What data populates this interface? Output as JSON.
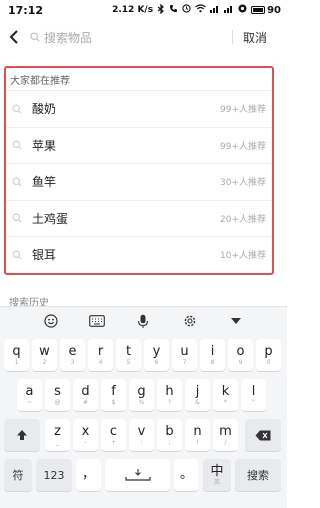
{
  "status_bar": {
    "time": "17:12",
    "speed": "2.12 K/s",
    "battery": "90"
  },
  "search": {
    "placeholder": "搜索物品",
    "cancel_label": "取消"
  },
  "recommend": {
    "title": "大家都在推荐",
    "items": [
      {
        "name": "酸奶",
        "count": "99+人推荐"
      },
      {
        "name": "苹果",
        "count": "99+人推荐"
      },
      {
        "name": "鱼竿",
        "count": "30+人推荐"
      },
      {
        "name": "土鸡蛋",
        "count": "20+人推荐"
      },
      {
        "name": "银耳",
        "count": "10+人推荐"
      }
    ]
  },
  "history": {
    "title": "搜索历史"
  },
  "keyboard": {
    "row1": [
      {
        "main": "q",
        "sub": "1"
      },
      {
        "main": "w",
        "sub": "2"
      },
      {
        "main": "e",
        "sub": "3"
      },
      {
        "main": "r",
        "sub": "4"
      },
      {
        "main": "t",
        "sub": "5"
      },
      {
        "main": "y",
        "sub": "6"
      },
      {
        "main": "u",
        "sub": "7"
      },
      {
        "main": "i",
        "sub": "8"
      },
      {
        "main": "o",
        "sub": "9"
      },
      {
        "main": "p",
        "sub": "0"
      }
    ],
    "row2": [
      {
        "main": "a",
        "sub": "~"
      },
      {
        "main": "s",
        "sub": "@"
      },
      {
        "main": "d",
        "sub": "#"
      },
      {
        "main": "f",
        "sub": "$"
      },
      {
        "main": "g",
        "sub": "%"
      },
      {
        "main": "h",
        "sub": "?"
      },
      {
        "main": "j",
        "sub": "&"
      },
      {
        "main": "k",
        "sub": "*"
      },
      {
        "main": "l",
        "sub": "\""
      }
    ],
    "row3": [
      {
        "main": "z",
        "sub": "_"
      },
      {
        "main": "x",
        "sub": "-"
      },
      {
        "main": "c",
        "sub": "+"
      },
      {
        "main": "v",
        "sub": ":"
      },
      {
        "main": "b",
        "sub": ";"
      },
      {
        "main": "n",
        "sub": "!"
      },
      {
        "main": "m",
        "sub": "/"
      }
    ],
    "symbol_label": "符",
    "number_label": "123",
    "comma_label": "，",
    "period_label": "。",
    "lang_label": "中",
    "lang_sub": "英",
    "search_label": "搜索"
  }
}
